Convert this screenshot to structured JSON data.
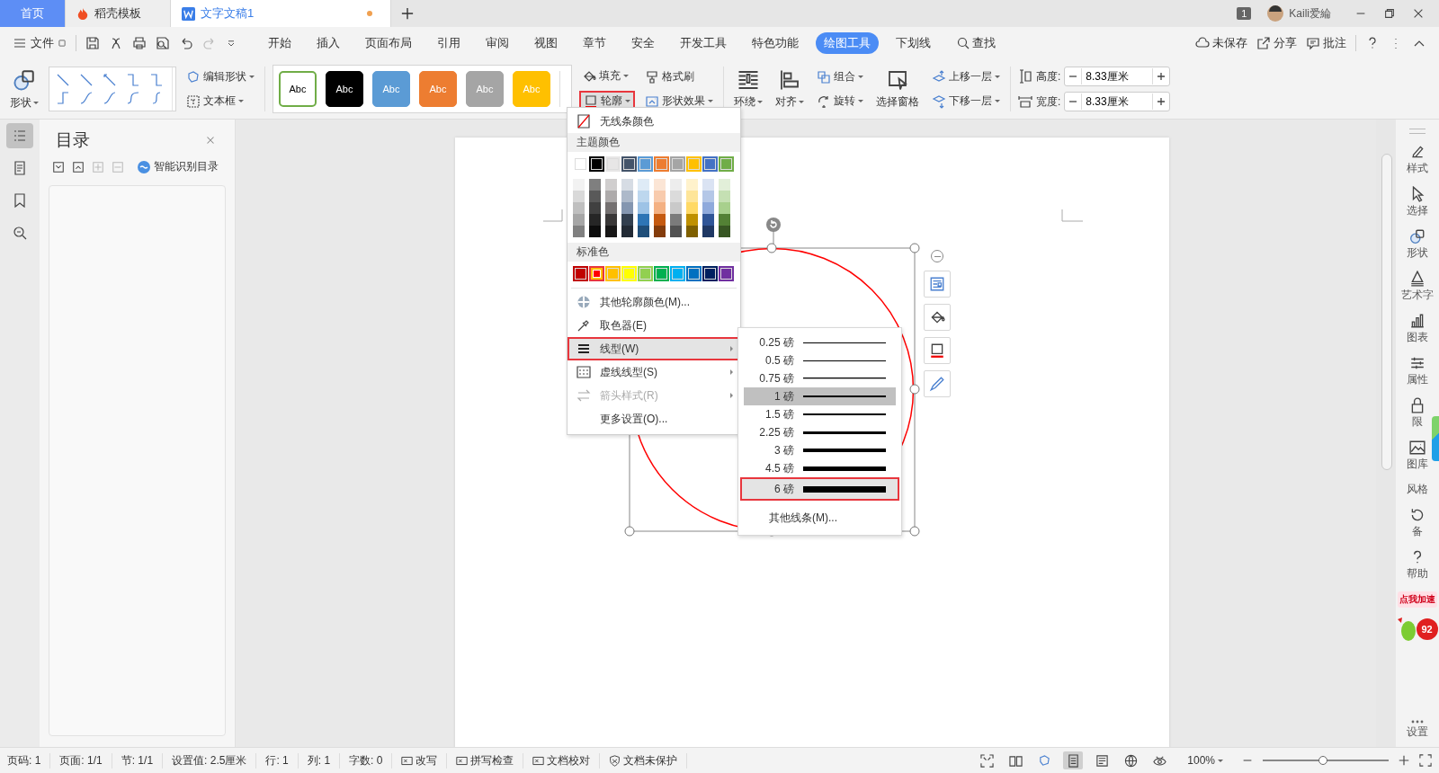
{
  "tabs": [
    {
      "label": "首页",
      "kind": "home",
      "selected": false,
      "unsaved": false
    },
    {
      "label": "稻壳模板",
      "kind": "docer",
      "selected": false,
      "unsaved": false
    },
    {
      "label": "文字文稿1",
      "kind": "doc",
      "selected": true,
      "unsaved": true
    }
  ],
  "title_bar": {
    "window_count": "1",
    "user": "Kaili爱綸"
  },
  "menu_bar": {
    "file": "文件",
    "tabs": [
      {
        "label": "开始",
        "selected": false
      },
      {
        "label": "插入",
        "selected": false
      },
      {
        "label": "页面布局",
        "selected": false
      },
      {
        "label": "引用",
        "selected": false
      },
      {
        "label": "审阅",
        "selected": false
      },
      {
        "label": "视图",
        "selected": false
      },
      {
        "label": "章节",
        "selected": false
      },
      {
        "label": "安全",
        "selected": false
      },
      {
        "label": "开发工具",
        "selected": false
      },
      {
        "label": "特色功能",
        "selected": false
      },
      {
        "label": "绘图工具",
        "selected": true
      },
      {
        "label": "下划线",
        "selected": false
      }
    ],
    "search": "查找",
    "actions": [
      {
        "label": "未保存",
        "kind": "cloud"
      },
      {
        "label": "分享",
        "kind": "share"
      },
      {
        "label": "批注",
        "kind": "comment"
      }
    ]
  },
  "ribbon": {
    "shape": "形状",
    "edit_shape": "编辑形状",
    "text_box": "文本框",
    "styles": [
      {
        "label": "Abc",
        "kind": "outlined",
        "color": "#70ad47"
      },
      {
        "label": "Abc",
        "kind": "filled",
        "color": "#000000"
      },
      {
        "label": "Abc",
        "kind": "filled",
        "color": "#5b9bd5"
      },
      {
        "label": "Abc",
        "kind": "filled",
        "color": "#ed7d31"
      },
      {
        "label": "Abc",
        "kind": "filled",
        "color": "#a5a5a5"
      },
      {
        "label": "Abc",
        "kind": "filled",
        "color": "#ffc000"
      }
    ],
    "fill": "填充",
    "format_painter": "格式刷",
    "outline": {
      "label": "轮廓",
      "annotated": true
    },
    "shape_effects": "形状效果",
    "wrap": "环绕",
    "align": "对齐",
    "group": "组合",
    "rotate": "旋转",
    "selection_pane": "选择窗格",
    "bring_forward": "上移一层",
    "send_backward": "下移一层",
    "height": {
      "label": "高度:",
      "value": "8.33厘米"
    },
    "width": {
      "label": "宽度:",
      "value": "8.33厘米"
    }
  },
  "nav_icons": [
    {
      "kind": "toc",
      "selected": true
    },
    {
      "kind": "pages",
      "selected": false
    },
    {
      "kind": "bookmark",
      "selected": false
    },
    {
      "kind": "find",
      "selected": false
    }
  ],
  "toc_panel": {
    "title": "目录",
    "smart": "智能识别目录"
  },
  "outline_menu": {
    "no_line": "无线条颜色",
    "theme_header": "主题颜色",
    "theme_colors": [
      {
        "color": "#ffffff",
        "shades": [
          {
            "color": "#f2f2f2"
          },
          {
            "color": "#d9d9d9"
          },
          {
            "color": "#bfbfbf"
          },
          {
            "color": "#a6a6a6"
          },
          {
            "color": "#808080"
          }
        ]
      },
      {
        "color": "#000000",
        "shades": [
          {
            "color": "#7f7f7f"
          },
          {
            "color": "#595959"
          },
          {
            "color": "#404040"
          },
          {
            "color": "#262626"
          },
          {
            "color": "#0d0d0d"
          }
        ]
      },
      {
        "color": "#e7e6e6",
        "shades": [
          {
            "color": "#d0cece"
          },
          {
            "color": "#aeabab"
          },
          {
            "color": "#757171"
          },
          {
            "color": "#3a3838"
          },
          {
            "color": "#181717"
          }
        ]
      },
      {
        "color": "#44546a",
        "shades": [
          {
            "color": "#d6dce4"
          },
          {
            "color": "#adb9ca"
          },
          {
            "color": "#8496b0"
          },
          {
            "color": "#323f4f"
          },
          {
            "color": "#222a35"
          }
        ]
      },
      {
        "color": "#5b9bd5",
        "shades": [
          {
            "color": "#deebf6"
          },
          {
            "color": "#bdd7ee"
          },
          {
            "color": "#9dc3e6"
          },
          {
            "color": "#2e75b5"
          },
          {
            "color": "#1f4e79"
          }
        ]
      },
      {
        "color": "#ed7d31",
        "shades": [
          {
            "color": "#fbe5d5"
          },
          {
            "color": "#f8cbad"
          },
          {
            "color": "#f4b183"
          },
          {
            "color": "#c55a11"
          },
          {
            "color": "#843c0c"
          }
        ]
      },
      {
        "color": "#a5a5a5",
        "shades": [
          {
            "color": "#ededed"
          },
          {
            "color": "#dbdbdb"
          },
          {
            "color": "#c9c9c9"
          },
          {
            "color": "#7b7b7b"
          },
          {
            "color": "#525252"
          }
        ]
      },
      {
        "color": "#ffc000",
        "shades": [
          {
            "color": "#fff2cc"
          },
          {
            "color": "#fee599"
          },
          {
            "color": "#ffd965"
          },
          {
            "color": "#bf9000"
          },
          {
            "color": "#7f6000"
          }
        ]
      },
      {
        "color": "#4472c4",
        "shades": [
          {
            "color": "#dae3f3"
          },
          {
            "color": "#b4c7e7"
          },
          {
            "color": "#8faadc"
          },
          {
            "color": "#2f5597"
          },
          {
            "color": "#1f3864"
          }
        ]
      },
      {
        "color": "#70ad47",
        "shades": [
          {
            "color": "#e2efd9"
          },
          {
            "color": "#c5e0b3"
          },
          {
            "color": "#a8d08d"
          },
          {
            "color": "#538135"
          },
          {
            "color": "#375623"
          }
        ]
      }
    ],
    "standard_header": "标准色",
    "standard_colors": [
      {
        "color": "#c00000",
        "selected": false,
        "annotated": false
      },
      {
        "color": "#ff0000",
        "selected": true,
        "annotated": true
      },
      {
        "color": "#ffc000",
        "selected": false,
        "annotated": false
      },
      {
        "color": "#ffff00",
        "selected": false,
        "annotated": false
      },
      {
        "color": "#92d050",
        "selected": false,
        "annotated": false
      },
      {
        "color": "#00b050",
        "selected": false,
        "annotated": false
      },
      {
        "color": "#00b0f0",
        "selected": false,
        "annotated": false
      },
      {
        "color": "#0070c0",
        "selected": false,
        "annotated": false
      },
      {
        "color": "#002060",
        "selected": false,
        "annotated": false
      },
      {
        "color": "#7030a0",
        "selected": false,
        "annotated": false
      }
    ],
    "items": [
      {
        "label": "其他轮廓颜色(M)...",
        "kind": "palette",
        "submenu": false,
        "highlighted": false,
        "disabled": false,
        "annotated": false
      },
      {
        "label": "取色器(E)",
        "kind": "picker",
        "submenu": false,
        "highlighted": false,
        "disabled": false,
        "annotated": false
      },
      {
        "label": "线型(W)",
        "kind": "lines",
        "submenu": true,
        "highlighted": true,
        "disabled": false,
        "annotated": true
      },
      {
        "label": "虚线线型(S)",
        "kind": "dash",
        "submenu": true,
        "highlighted": false,
        "disabled": false,
        "annotated": false
      },
      {
        "label": "箭头样式(R)",
        "kind": "arrow",
        "submenu": true,
        "highlighted": false,
        "disabled": true,
        "annotated": false
      },
      {
        "label": "更多设置(O)...",
        "kind": "none",
        "submenu": false,
        "highlighted": false,
        "disabled": false,
        "annotated": false
      }
    ]
  },
  "line_weight_menu": {
    "items": [
      {
        "label": "0.25 磅",
        "selected": false,
        "hovered": false,
        "annotated": false
      },
      {
        "label": "0.5 磅",
        "selected": false,
        "hovered": false,
        "annotated": false
      },
      {
        "label": "0.75 磅",
        "selected": false,
        "hovered": false,
        "annotated": false
      },
      {
        "label": "1 磅",
        "selected": true,
        "hovered": false,
        "annotated": false
      },
      {
        "label": "1.5 磅",
        "selected": false,
        "hovered": false,
        "annotated": false
      },
      {
        "label": "2.25 磅",
        "selected": false,
        "hovered": false,
        "annotated": false
      },
      {
        "label": "3 磅",
        "selected": false,
        "hovered": false,
        "annotated": false
      },
      {
        "label": "4.5 磅",
        "selected": false,
        "hovered": false,
        "annotated": false
      },
      {
        "label": "6 磅",
        "selected": false,
        "hovered": true,
        "annotated": true
      }
    ],
    "more": "其他线条(M)..."
  },
  "shape": {
    "color": "#ff0000"
  },
  "right_sidebar": {
    "items": [
      {
        "label": "样式",
        "kind": "style"
      },
      {
        "label": "选择",
        "kind": "select"
      },
      {
        "label": "形状",
        "kind": "shape"
      },
      {
        "label": "艺术字",
        "kind": "art"
      },
      {
        "label": "图表",
        "kind": "chart"
      },
      {
        "label": "属性",
        "kind": "props"
      },
      {
        "label": "限",
        "kind": "lock"
      },
      {
        "label": "图库",
        "kind": "gallery"
      },
      {
        "label": "风格",
        "kind": "none"
      },
      {
        "label": "备",
        "kind": "backup"
      },
      {
        "label": "帮助",
        "kind": "help"
      },
      {
        "label": "设置",
        "kind": "more"
      }
    ],
    "promo": "点我加速",
    "promo_badge": "92"
  },
  "status_bar": {
    "fields": [
      "页码: 1",
      "页面: 1/1",
      "节: 1/1",
      "设置值: 2.5厘米",
      "行: 1",
      "列: 1",
      "字数: 0"
    ],
    "toggles": [
      {
        "label": "改写",
        "kind": "box"
      },
      {
        "label": "拼写检查",
        "kind": "box"
      },
      {
        "label": "文档校对",
        "kind": "box"
      },
      {
        "label": "文档未保护",
        "kind": "shield"
      }
    ],
    "views": [
      {
        "kind": "fullscreen",
        "selected": false
      },
      {
        "kind": "read",
        "selected": false
      },
      {
        "kind": "edit",
        "selected": false
      },
      {
        "kind": "page",
        "selected": true
      },
      {
        "kind": "outline",
        "selected": false
      },
      {
        "kind": "web",
        "selected": false
      },
      {
        "kind": "eye",
        "selected": false
      }
    ],
    "zoom": "100%",
    "zoom_slider": {
      "level": 0.48
    }
  }
}
